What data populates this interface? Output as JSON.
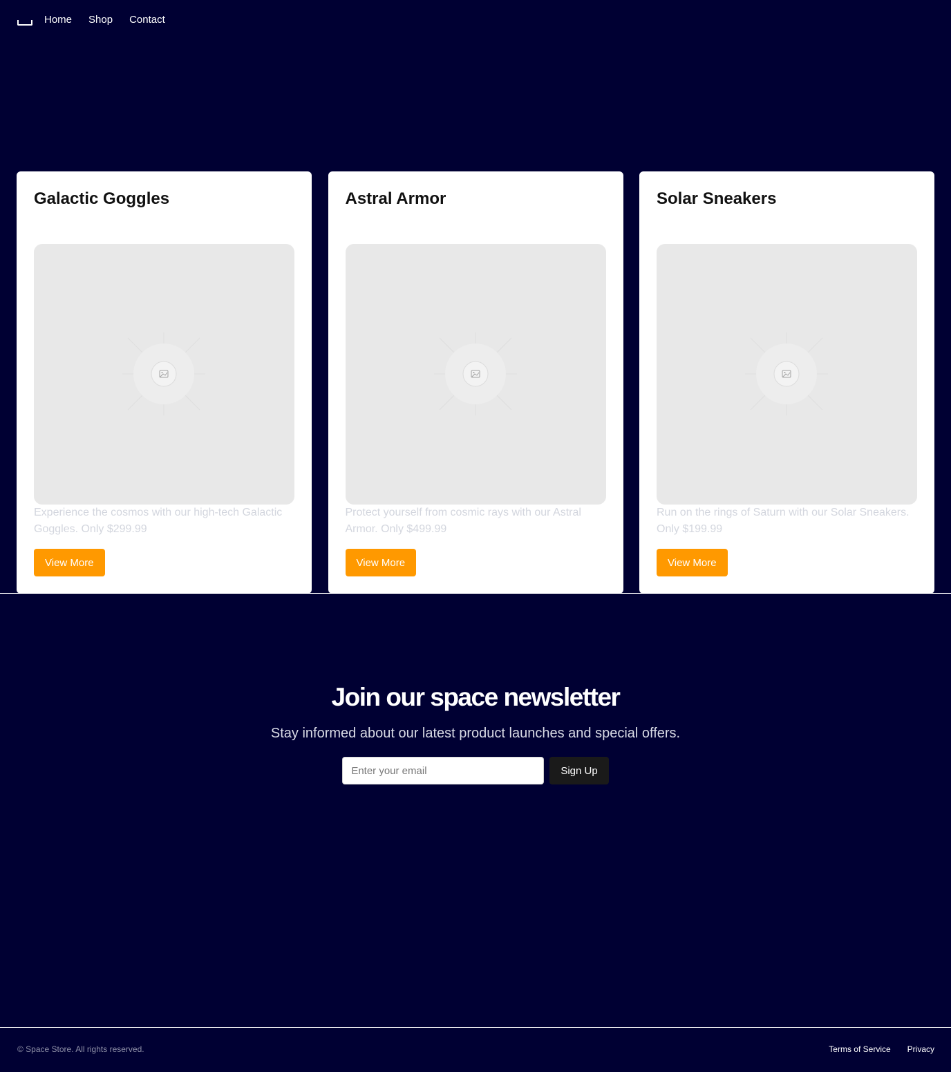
{
  "nav": {
    "logo_icon": "bracket-logo-icon",
    "links": [
      "Home",
      "Shop",
      "Contact"
    ]
  },
  "products": [
    {
      "title": "Galactic Goggles",
      "description": "Experience the cosmos with our high-tech Galactic Goggles. Only $299.99",
      "button": "View More",
      "image_icon": "image-placeholder-icon"
    },
    {
      "title": "Astral Armor",
      "description": "Protect yourself from cosmic rays with our Astral Armor. Only $499.99",
      "button": "View More",
      "image_icon": "image-placeholder-icon"
    },
    {
      "title": "Solar Sneakers",
      "description": "Run on the rings of Saturn with our Solar Sneakers. Only $199.99",
      "button": "View More",
      "image_icon": "image-placeholder-icon"
    }
  ],
  "newsletter": {
    "heading": "Join our space newsletter",
    "subtext": "Stay informed about our latest product launches and special offers.",
    "email_placeholder": "Enter your email",
    "button": "Sign Up"
  },
  "footer": {
    "copyright": "© Space Store. All rights reserved.",
    "links": [
      "Terms of Service",
      "Privacy"
    ]
  },
  "colors": {
    "background": "#000033",
    "accent": "#ff9900",
    "card": "#ffffff",
    "signup_button": "#1a1a1a"
  }
}
